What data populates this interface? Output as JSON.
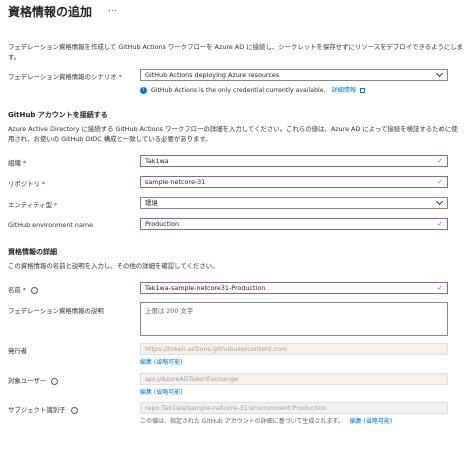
{
  "header": {
    "title": "資格情報の追加",
    "more": "…"
  },
  "intro": "フェデレーション資格情報を作成して GitHub Actions ワークフローを Azure AD に接続し、シークレットを保存せずにリソースをデプロイできるようにします。",
  "scenario": {
    "label": "フェデレーション資格情報のシナリオ",
    "required": "*",
    "value": "GitHub Actions deploying Azure resources",
    "info": "GitHub Actions is the only credential currently available.",
    "info_link": "詳細情報"
  },
  "connect": {
    "heading": "GitHub アカウントを接続する",
    "desc": "Azure Active Directory に接続する GitHub Actions ワークフローの詳細を入力してください。これらの値は、Azure AD によって接続を検証するために使用され、お使いの GitHub OIDC 構成と一致している必要があります。",
    "org_label": "組織",
    "org_value": "Tak1wa",
    "repo_label": "リポジトリ",
    "repo_value": "sample-netcore-31",
    "entity_label": "エンティティ型",
    "entity_value": "環境",
    "env_label": "GitHub environment name",
    "env_value": "Production",
    "required": "*"
  },
  "details": {
    "heading": "資格情報の詳細",
    "desc": "この資格情報の名前と説明を入力し、その他の詳細を確認してください。",
    "name_label": "名前",
    "name_value": "Tak1wa-sample-netcore31-Production",
    "desc_label": "フェデレーション資格情報の説明",
    "desc_placeholder": "上限は 200 文字",
    "issuer_label": "発行者",
    "issuer_value": "https://token.actions.githubusercontent.com",
    "issuer_edit": "編集 (省略可能)",
    "audience_label": "対象ユーザー",
    "audience_value": "api://AzureADTokenExchange",
    "audience_edit": "編集 (省略可能)",
    "subject_label": "サブジェクト識別子",
    "subject_value": "repo:Tak1wa/sample-netcore-31:environment:Production",
    "subject_hint": "この値は、指定された GitHub アカウントの詳細に基づいて生成されます。",
    "subject_edit": "編集 (省略可能)",
    "required": "*"
  },
  "colors": {
    "focus_border": "#8764b8",
    "valid_check": "#57a300",
    "link": "#0078d4",
    "required": "#a4262c"
  }
}
